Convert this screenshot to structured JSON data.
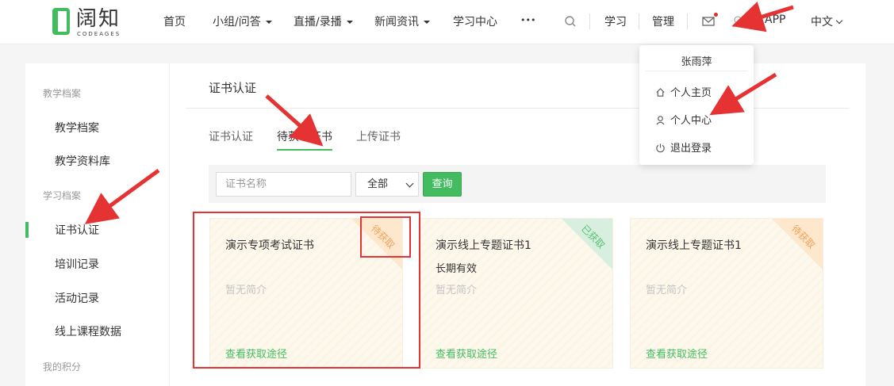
{
  "header": {
    "logo_text": "阔知",
    "logo_sub": "CODEAGES",
    "nav": [
      {
        "label": "首页"
      },
      {
        "label": "小组/问答"
      },
      {
        "label": "直播/录播"
      },
      {
        "label": "新闻资讯"
      },
      {
        "label": "学习中心"
      },
      {
        "label": "•••"
      }
    ],
    "study": "学习",
    "manage": "管理",
    "app": "APP",
    "lang": "中文"
  },
  "dropdown": {
    "username": "张雨萍",
    "items": [
      {
        "label": "个人主页",
        "icon": "home-icon"
      },
      {
        "label": "个人中心",
        "icon": "user-icon"
      },
      {
        "label": "退出登录",
        "icon": "power-icon"
      }
    ]
  },
  "sidebar": {
    "groups": [
      {
        "label": "教学档案"
      },
      {
        "label": "学习档案"
      },
      {
        "label": "我的积分"
      }
    ],
    "items": [
      {
        "label": "教学档案"
      },
      {
        "label": "教学资料库"
      },
      {
        "label": "证书认证"
      },
      {
        "label": "培训记录"
      },
      {
        "label": "活动记录"
      },
      {
        "label": "线上课程数据"
      }
    ],
    "active_index": 2
  },
  "main": {
    "title": "证书认证",
    "tabs": [
      {
        "label": "证书认证"
      },
      {
        "label": "待获取证书"
      },
      {
        "label": "上传证书"
      }
    ],
    "active_tab": 1,
    "filter": {
      "placeholder": "证书名称",
      "select_value": "全部",
      "query_label": "查询"
    }
  },
  "cards": [
    {
      "title": "演示专项考试证书",
      "validity": "",
      "desc": "暂无简介",
      "link": "查看获取途径",
      "status": "待获取",
      "status_type": "pending"
    },
    {
      "title": "演示线上专题证书1",
      "validity": "长期有效",
      "desc": "暂无简介",
      "link": "查看获取途径",
      "status": "已获取",
      "status_type": "done"
    },
    {
      "title": "演示线上专题证书1",
      "validity": "",
      "desc": "暂无简介",
      "link": "查看获取途径",
      "status": "待获取",
      "status_type": "pending"
    }
  ],
  "colors": {
    "accent": "#43bc60",
    "annotation": "#e53333",
    "pending": "#f2a25a"
  }
}
